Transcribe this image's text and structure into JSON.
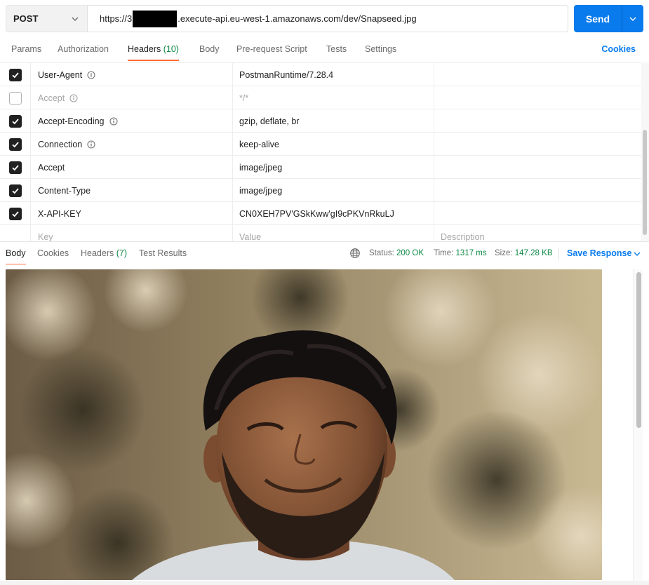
{
  "request": {
    "method": "POST",
    "url_prefix": "https://3",
    "url_suffix": ".execute-api.eu-west-1.amazonaws.com/dev/Snapseed.jpg",
    "send_label": "Send"
  },
  "request_tabs": [
    {
      "label": "Params",
      "count": ""
    },
    {
      "label": "Authorization",
      "count": ""
    },
    {
      "label": "Headers",
      "count": "(10)"
    },
    {
      "label": "Body",
      "count": ""
    },
    {
      "label": "Pre-request Script",
      "count": ""
    },
    {
      "label": "Tests",
      "count": ""
    },
    {
      "label": "Settings",
      "count": ""
    }
  ],
  "cookies_label": "Cookies",
  "headers": [
    {
      "key": "User-Agent",
      "value": "PostmanRuntime/7.28.4",
      "checked": true,
      "info": true
    },
    {
      "key": "Accept",
      "value": "*/*",
      "checked": false,
      "info": true
    },
    {
      "key": "Accept-Encoding",
      "value": "gzip, deflate, br",
      "checked": true,
      "info": true
    },
    {
      "key": "Connection",
      "value": "keep-alive",
      "checked": true,
      "info": true
    },
    {
      "key": "Accept",
      "value": "image/jpeg",
      "checked": true,
      "info": false
    },
    {
      "key": "Content-Type",
      "value": "image/jpeg",
      "checked": true,
      "info": false
    },
    {
      "key": "X-API-KEY",
      "value": "CN0XEH7PV'GSkKww'gI9cPKVnRkuLJ",
      "checked": true,
      "info": false
    }
  ],
  "placeholders": {
    "key": "Key",
    "value": "Value",
    "description": "Description"
  },
  "response_tabs": [
    {
      "label": "Body",
      "count": ""
    },
    {
      "label": "Cookies",
      "count": ""
    },
    {
      "label": "Headers",
      "count": "(7)"
    },
    {
      "label": "Test Results",
      "count": ""
    }
  ],
  "response_meta": {
    "status_label": "Status:",
    "status_value": "200 OK",
    "time_label": "Time:",
    "time_value": "1317 ms",
    "size_label": "Size:",
    "size_value": "147.28 KB",
    "save_label": "Save Response"
  },
  "colors": {
    "accent": "#097bed",
    "tab_indicator": "#ff6c37",
    "success": "#0c8a43"
  },
  "icons": [
    "chevron-down-icon",
    "info-icon",
    "checkmark-icon",
    "globe-icon"
  ]
}
